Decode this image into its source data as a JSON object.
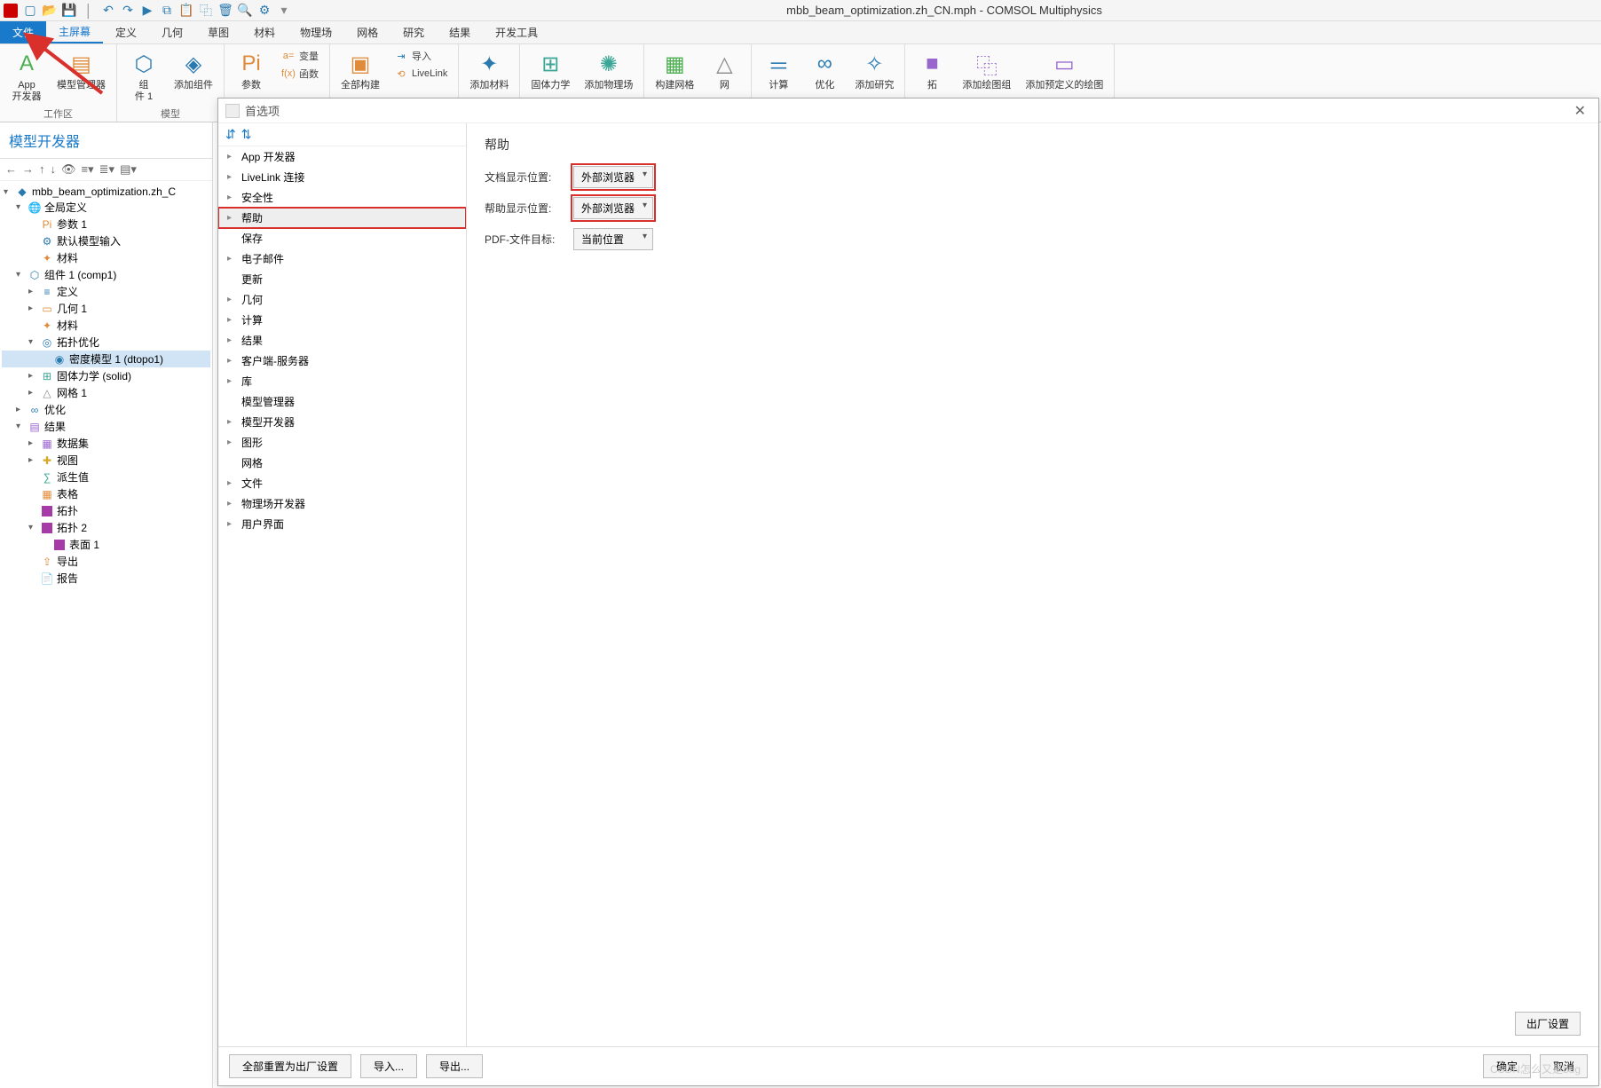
{
  "titlebar": {
    "title": "mbb_beam_optimization.zh_CN.mph - COMSOL Multiphysics"
  },
  "menu": {
    "file": "文件",
    "home": "主屏幕",
    "def": "定义",
    "geom": "几何",
    "sketch": "草图",
    "mat": "材料",
    "phys": "物理场",
    "mesh": "网格",
    "study": "研究",
    "results": "结果",
    "dev": "开发工具"
  },
  "ribbon": {
    "app_builder": "App\n开发器",
    "model_mgr": "模型管理器",
    "component": "组\n件 1",
    "add_comp": "添加组件",
    "params": "参数",
    "var": "变量",
    "func": "函数",
    "build_all": "全部构建",
    "import": "导入",
    "livelink": "LiveLink",
    "add_mat": "添加材料",
    "solid": "固体力学",
    "add_phys": "添加物理场",
    "build_mesh": "构建网格",
    "mesh": "网",
    "compute": "计算",
    "optimize": "优化",
    "add_study": "添加研究",
    "topo": "拓",
    "add_plot_group": "添加绘图组",
    "add_predef_plot": "添加预定义的绘图",
    "group_workspace": "工作区",
    "group_model": "模型",
    "pi": "Pi",
    "a_eq": "a=",
    "fx": "f(x)"
  },
  "model_builder": {
    "title": "模型开发器",
    "root": "mbb_beam_optimization.zh_C",
    "global_def": "全局定义",
    "param1": "参数 1",
    "default_input": "默认模型输入",
    "materials": "材料",
    "comp1": "组件 1  (comp1)",
    "defs": "定义",
    "geom1": "几何 1",
    "mat2": "材料",
    "topo_opt": "拓扑优化",
    "density_model": "密度模型 1  (dtopo1)",
    "solid_label": "固体力学  (solid)",
    "mesh1": "网格 1",
    "optimization": "优化",
    "results": "结果",
    "datasets": "数据集",
    "views": "视图",
    "derived": "派生值",
    "tables": "表格",
    "topo": "拓扑",
    "topo2": "拓扑 2",
    "surface1": "表面 1",
    "export": "导出",
    "report": "报告"
  },
  "dialog": {
    "title": "首选项",
    "categories": {
      "app_dev": "App 开发器",
      "livelink": "LiveLink 连接",
      "security": "安全性",
      "help": "帮助",
      "save": "保存",
      "email": "电子邮件",
      "update": "更新",
      "geom": "几何",
      "compute": "计算",
      "results": "结果",
      "client_server": "客户端-服务器",
      "library": "库",
      "model_mgr": "模型管理器",
      "model_dev": "模型开发器",
      "graphics": "图形",
      "mesh": "网格",
      "file": "文件",
      "phys_dev": "物理场开发器",
      "ui": "用户界面"
    },
    "panel": {
      "heading": "帮助",
      "doc_location_label": "文档显示位置:",
      "doc_location_value": "外部浏览器",
      "help_location_label": "帮助显示位置:",
      "help_location_value": "外部浏览器",
      "pdf_target_label": "PDF-文件目标:",
      "pdf_target_value": "当前位置",
      "factory": "出厂设置"
    },
    "footer": {
      "reset_all": "全部重置为出厂设置",
      "import": "导入...",
      "export": "导出...",
      "ok": "确定",
      "cancel": "取消"
    }
  },
  "watermark": "CSDN怎么又是bug"
}
